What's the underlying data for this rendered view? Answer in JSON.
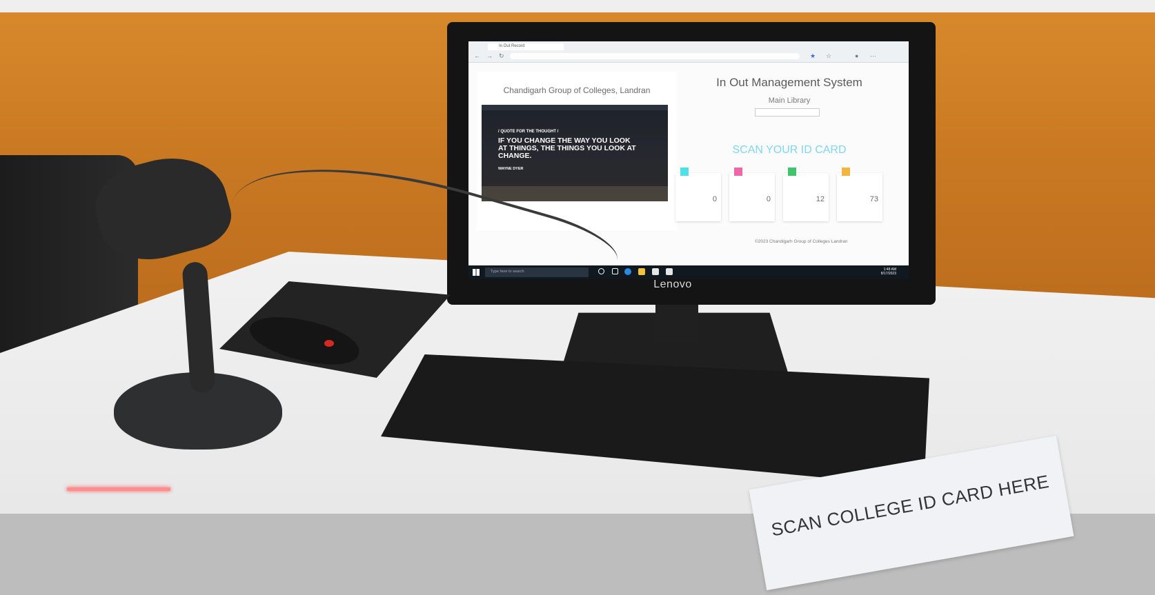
{
  "browser": {
    "tab_title": "In Out Record"
  },
  "page": {
    "college_name": "Chandigarh Group of Colleges, Landran",
    "quote_kicker": "/ QUOTE FOR THE THOUGHT /",
    "quote_text": "IF YOU CHANGE THE WAY YOU LOOK AT THINGS, THE THINGS YOU LOOK AT CHANGE.",
    "quote_author": "WAYNE DYER",
    "system_title": "In Out Management System",
    "library_name": "Main Library",
    "scan_prompt": "SCAN YOUR ID CARD",
    "stats": [
      {
        "value": "0",
        "color": "#4de0e6"
      },
      {
        "value": "0",
        "color": "#f066a8"
      },
      {
        "value": "12",
        "color": "#40c66a"
      },
      {
        "value": "73",
        "color": "#f2b540"
      }
    ],
    "footer": "©2023 Chandigarh Group of Colleges Landran"
  },
  "taskbar": {
    "search_placeholder": "Type here to search",
    "time": "1:48 AM",
    "date": "8/17/2023"
  },
  "monitor": {
    "brand": "Lenovo"
  },
  "sign": {
    "text": "SCAN COLLEGE ID CARD HERE"
  }
}
